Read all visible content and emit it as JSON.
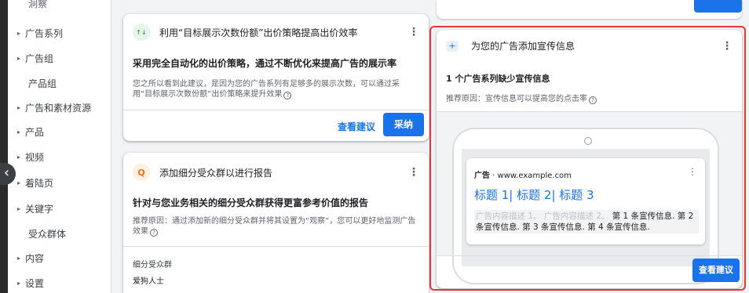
{
  "sidebar": {
    "cut_item": "洞察",
    "items": [
      {
        "label": "广告系列",
        "arrow": "▸"
      },
      {
        "label": "广告组",
        "arrow": "▸"
      },
      {
        "label": "产品组",
        "arrow": ""
      },
      {
        "label": "广告和素材资源",
        "arrow": "▸"
      },
      {
        "label": "产品",
        "arrow": "▸"
      },
      {
        "label": "视频",
        "arrow": "▸"
      },
      {
        "label": "着陆页",
        "arrow": "▸"
      },
      {
        "label": "关键字",
        "arrow": "▸"
      },
      {
        "label": "受众群体",
        "arrow": ""
      },
      {
        "label": "内容",
        "arrow": "▸"
      },
      {
        "label": "设置",
        "arrow": "▸"
      }
    ],
    "collapse_glyph": "‹"
  },
  "card_bidding": {
    "icon": "trend-up-icon",
    "icon_glyph": "↑↓",
    "title": "利用“目标展示次数份额”出价策略提高出价效率",
    "headline": "采用完全自动化的出价策略，通过不断优化来提高广告的展示率",
    "reason": "您之所以看到此建议，是因为您的广告系列有足够多的展示次数，可以通过采用“目标展示次数份额”出价策略来提升效果",
    "view_label": "查看建议",
    "apply_label": "采纳"
  },
  "card_audience": {
    "icon": "search-icon",
    "icon_glyph": "Q",
    "title": "添加细分受众群以进行报告",
    "headline": "针对与您业务相关的细分受众群获得更富参考价值的报告",
    "reason": "推荐原因：通过添加新的细分受众群并将其设置为“观察”，您可以更好地监测广告效果",
    "segment_header": "细分受众群",
    "segment_value": "爱狗人士"
  },
  "card_callout": {
    "icon": "add-callout-icon",
    "icon_glyph": "+",
    "title": "为您的广告添加宣传信息",
    "headline": "1 个广告系列缺少宣传信息",
    "reason": "推荐原因：宣传信息可以提高您的点击率",
    "view_label": "查看建议",
    "ad_preview": {
      "ad_label": "广告",
      "url": "· www.example.com",
      "title": "标题 1| 标题 2| 标题 3",
      "desc_faded": "广告内容描述 1。 广告内容描述 2。",
      "callouts": "第 1 条宣传信息. 第 2 条宣传信息. 第 3 条宣传信息. 第 4 条宣传信息."
    }
  },
  "colors": {
    "accent": "#1a73e8",
    "highlight_border": "#e8363b",
    "green_icon_bg": "#e6f4ea",
    "orange_icon_bg": "#fef0e1",
    "blue_icon_bg": "#e8f0fe"
  }
}
